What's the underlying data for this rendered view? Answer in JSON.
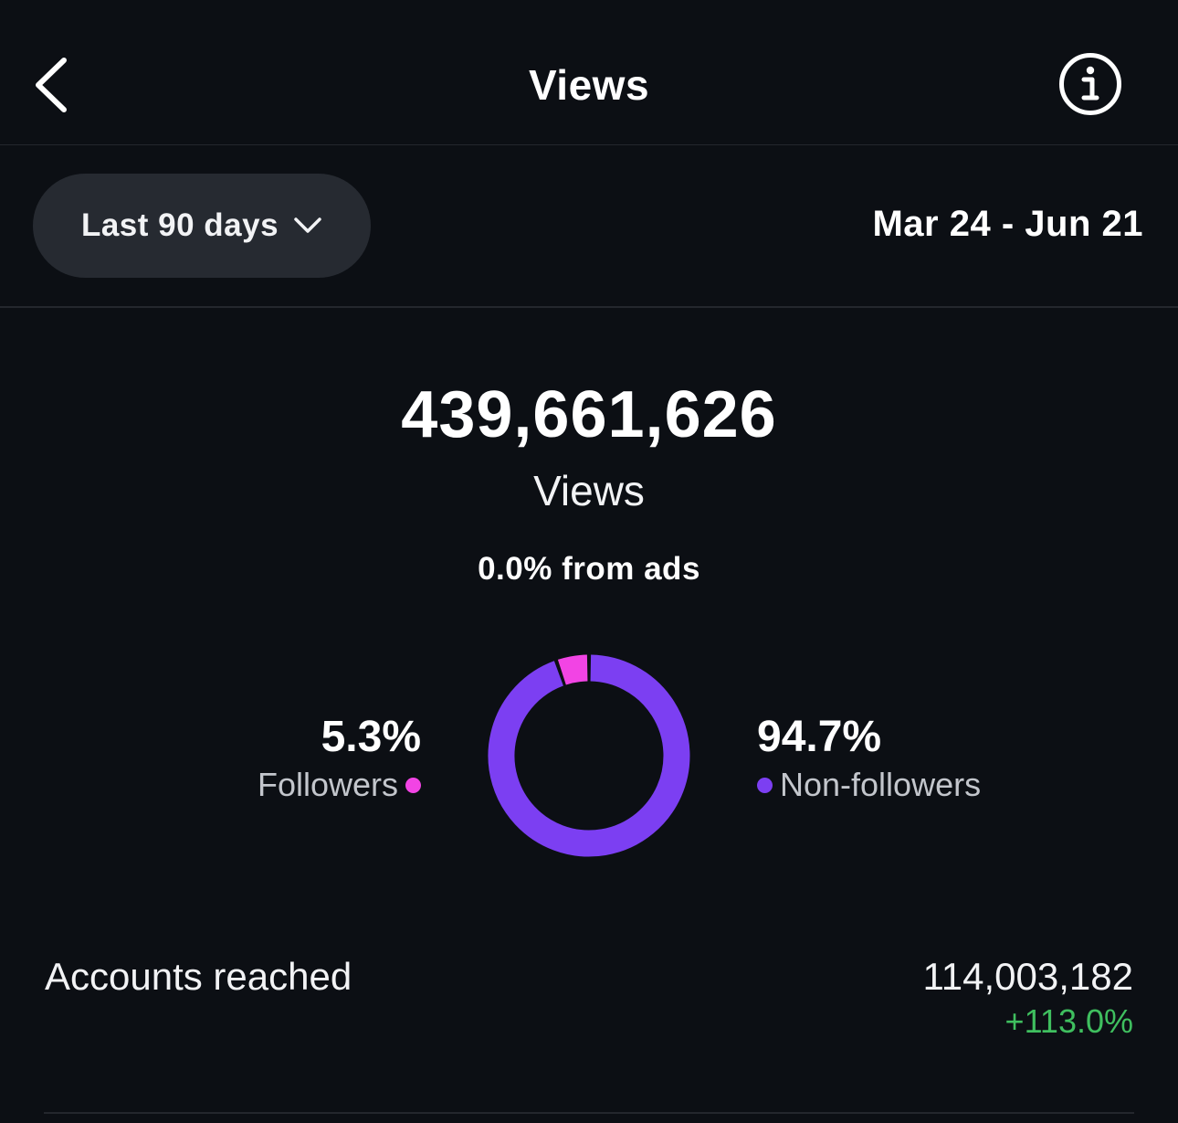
{
  "header": {
    "title": "Views"
  },
  "filter": {
    "range_label": "Last 90 days",
    "date_range": "Mar 24 - Jun 21"
  },
  "summary": {
    "total": "439,661,626",
    "total_label": "Views",
    "ads_note": "0.0% from ads"
  },
  "audience": {
    "followers": {
      "percent": "5.3%",
      "label": "Followers",
      "value": 5.3,
      "color": "#f244e4"
    },
    "non_followers": {
      "percent": "94.7%",
      "label": "Non-followers",
      "value": 94.7,
      "color": "#7c3ff2"
    }
  },
  "metrics": [
    {
      "label": "Accounts reached",
      "value": "114,003,182",
      "change": "+113.0%",
      "change_color": "#3fbf5f"
    }
  ],
  "icons": {
    "back": "chevron-left-icon",
    "info": "info-icon",
    "dropdown": "chevron-down-icon"
  }
}
